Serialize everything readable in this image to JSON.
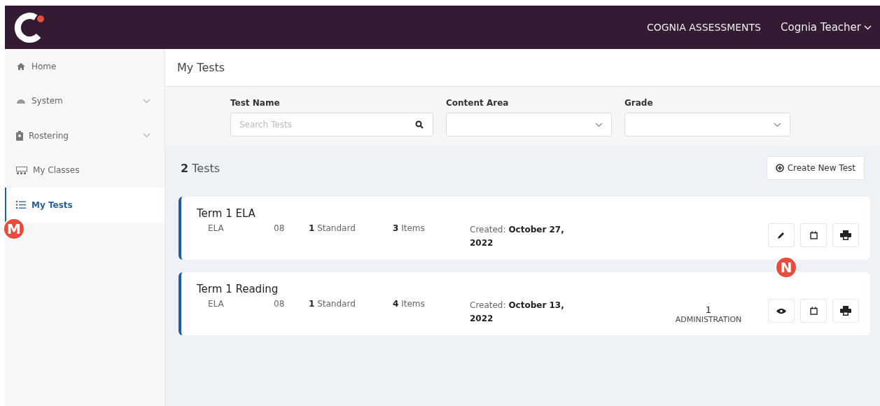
{
  "header": {
    "title": "COGNIA ASSESSMENTS",
    "user": "Cognia Teacher"
  },
  "sidebar": {
    "items": [
      {
        "kind": "home",
        "label": "Home",
        "expandable": false,
        "selected": false
      },
      {
        "kind": "gauge",
        "label": "System",
        "expandable": true,
        "selected": false
      },
      {
        "kind": "badge",
        "label": "Rostering",
        "expandable": true,
        "selected": false
      },
      {
        "kind": "classes",
        "label": "My Classes",
        "expandable": false,
        "selected": false
      },
      {
        "kind": "list",
        "label": "My Tests",
        "expandable": false,
        "selected": true
      }
    ]
  },
  "page_title": "My Tests",
  "filters": {
    "test_name": {
      "label": "Test Name",
      "placeholder": "Search Tests"
    },
    "content_area": {
      "label": "Content Area"
    },
    "grade": {
      "label": "Grade"
    }
  },
  "summary": {
    "count": "2",
    "label": "Tests"
  },
  "create_button": "Create New Test",
  "tests": [
    {
      "name": "Term 1 ELA",
      "subject": "ELA",
      "grade": "08",
      "standards_count": "1",
      "standards_label": "Standard",
      "items_count": "3",
      "items_label": "Items",
      "created_label": "Created:",
      "created_date": "October 27, 2022",
      "actions": [
        {
          "kind": "edit"
        },
        {
          "kind": "calendar"
        },
        {
          "kind": "print"
        }
      ]
    },
    {
      "name": "Term 1 Reading",
      "subject": "ELA",
      "grade": "08",
      "standards_count": "1",
      "standards_label": "Standard",
      "items_count": "4",
      "items_label": "Items",
      "created_label": "Created:",
      "created_date": "October 13, 2022",
      "administrations_count": "1",
      "administrations_label": "ADMINISTRATION",
      "actions": [
        {
          "kind": "view"
        },
        {
          "kind": "calendar"
        },
        {
          "kind": "print"
        }
      ]
    }
  ],
  "callouts": [
    {
      "label": "M"
    },
    {
      "label": "N"
    }
  ]
}
